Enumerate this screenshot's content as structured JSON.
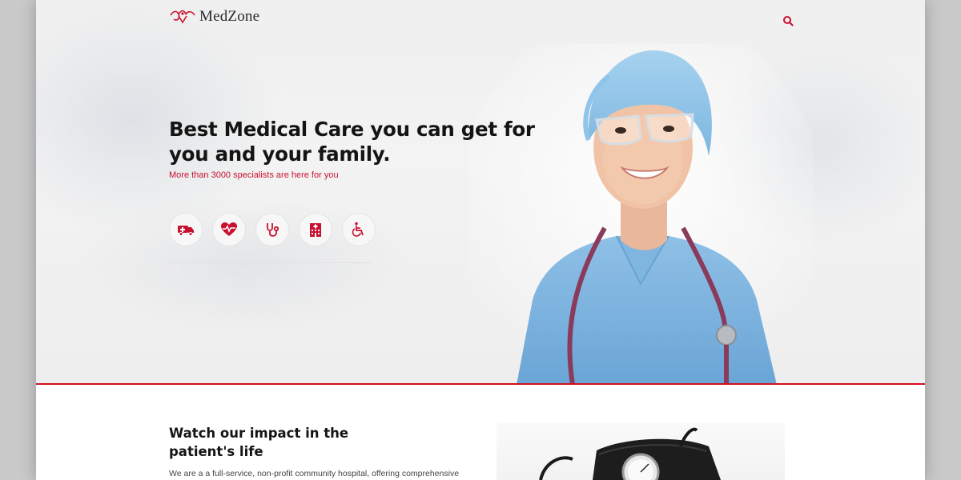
{
  "brand": {
    "name": "MedZone",
    "accent": "#c8102e"
  },
  "hero": {
    "title": "Best Medical Care you can get for you and your family.",
    "subtitle": "More than 3000 specialists are here for you",
    "features": [
      {
        "icon": "ambulance-icon"
      },
      {
        "icon": "heartbeat-icon"
      },
      {
        "icon": "stethoscope-icon"
      },
      {
        "icon": "hospital-icon"
      },
      {
        "icon": "wheelchair-icon"
      }
    ]
  },
  "impact": {
    "title": "Watch our impact in the patient's life",
    "text": "We are a a full-service, non-profit community hospital, offering comprehensive"
  }
}
